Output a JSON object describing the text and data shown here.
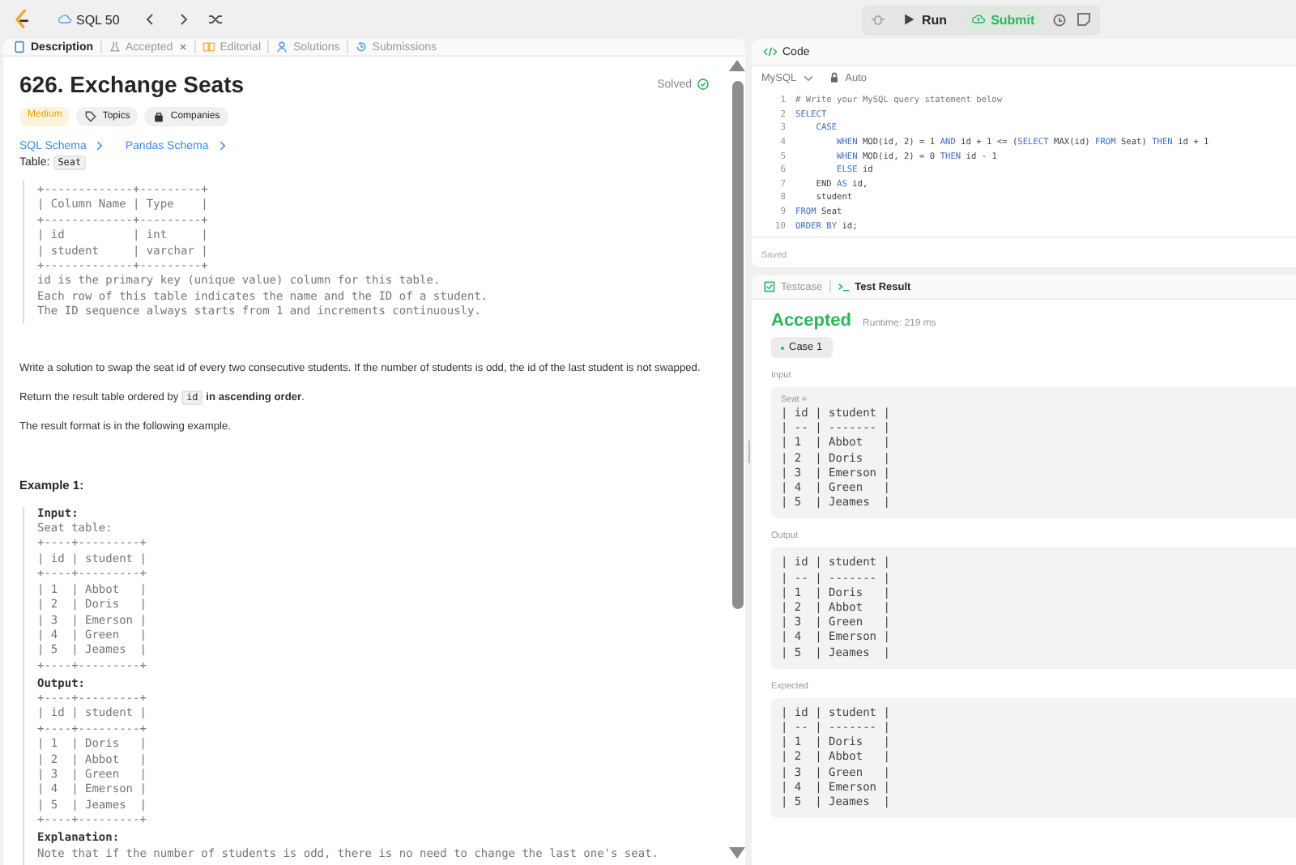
{
  "top_bar": {
    "problem_list": "SQL 50",
    "run": "Run",
    "submit": "Submit"
  },
  "description_tabs": [
    {
      "label": "Description",
      "selected": true,
      "closable": false
    },
    {
      "label": "Accepted",
      "selected": false,
      "closable": true
    },
    {
      "label": "Editorial",
      "selected": false,
      "closable": false
    },
    {
      "label": "Solutions",
      "selected": false,
      "closable": false
    },
    {
      "label": "Submissions",
      "selected": false,
      "closable": false
    }
  ],
  "problem": {
    "title": "626. Exchange Seats",
    "status": "Solved",
    "difficulty": "Medium",
    "tags": [
      "Topics",
      "Companies"
    ],
    "schema_links": [
      "SQL Schema",
      "Pandas Schema"
    ],
    "table_label": "Table:",
    "table_name": "Seat",
    "schema_block": "+-------------+---------+\n| Column Name | Type    |\n+-------------+---------+\n| id          | int     |\n| student     | varchar |\n+-------------+---------+\nid is the primary key (unique value) column for this table.\nEach row of this table indicates the name and the ID of a student.\nThe ID sequence always starts from 1 and increments continuously.",
    "paragraphs": [
      [
        {
          "kind": "plain",
          "text": "Write a solution to swap the seat id of every two consecutive students. If the number of students is odd, the id of the last student is not swapped."
        }
      ],
      [
        {
          "kind": "plain",
          "text": "Return the result table ordered by "
        },
        {
          "kind": "code",
          "text": "id"
        },
        {
          "kind": "bold",
          "text": " in ascending order"
        },
        {
          "kind": "plain",
          "text": "."
        }
      ],
      [
        {
          "kind": "plain",
          "text": "The result format is in the following example."
        }
      ]
    ],
    "example": {
      "title": "Example 1:",
      "sections": [
        {
          "label": "Input:",
          "text": "Seat table:\n+----+---------+\n| id | student |\n+----+---------+\n| 1  | Abbot   |\n| 2  | Doris   |\n| 3  | Emerson |\n| 4  | Green   |\n| 5  | Jeames  |\n+----+---------+"
        },
        {
          "label": "Output:",
          "text": "+----+---------+\n| id | student |\n+----+---------+\n| 1  | Doris   |\n| 2  | Abbot   |\n| 3  | Green   |\n| 4  | Emerson |\n| 5  | Jeames  |\n+----+---------+"
        },
        {
          "label": "Explanation:",
          "text": "Note that if the number of students is odd, there is no need to change the last one's seat."
        }
      ]
    }
  },
  "code_panel": {
    "title": "Code",
    "language": "MySQL",
    "mode": "Auto",
    "status": "Saved",
    "lines": [
      {
        "number": "1",
        "tokens": [
          {
            "kind": "comment",
            "text": "# Write your MySQL query statement below"
          }
        ]
      },
      {
        "number": "2",
        "tokens": [
          {
            "kind": "keyword",
            "text": "SELECT"
          }
        ]
      },
      {
        "number": "3",
        "tokens": [
          {
            "kind": "keyword",
            "text": "    CASE"
          }
        ]
      },
      {
        "number": "4",
        "tokens": [
          {
            "kind": "keyword",
            "text": "        WHEN"
          },
          {
            "kind": "plain",
            "text": " MOD(id, 2) = 1 "
          },
          {
            "kind": "keyword",
            "text": "AND"
          },
          {
            "kind": "plain",
            "text": " id + 1 <= ("
          },
          {
            "kind": "keyword",
            "text": "SELECT"
          },
          {
            "kind": "plain",
            "text": " MAX(id) "
          },
          {
            "kind": "keyword",
            "text": "FROM"
          },
          {
            "kind": "plain",
            "text": " Seat) "
          },
          {
            "kind": "keyword",
            "text": "THEN"
          },
          {
            "kind": "plain",
            "text": " id + 1"
          }
        ]
      },
      {
        "number": "5",
        "tokens": [
          {
            "kind": "keyword",
            "text": "        WHEN"
          },
          {
            "kind": "plain",
            "text": " MOD(id, 2) = 0 "
          },
          {
            "kind": "keyword",
            "text": "THEN"
          },
          {
            "kind": "plain",
            "text": " id - 1"
          }
        ]
      },
      {
        "number": "6",
        "tokens": [
          {
            "kind": "keyword",
            "text": "        ELSE"
          },
          {
            "kind": "plain",
            "text": " id"
          }
        ]
      },
      {
        "number": "7",
        "tokens": [
          {
            "kind": "plain",
            "text": "    END "
          },
          {
            "kind": "keyword",
            "text": "AS"
          },
          {
            "kind": "plain",
            "text": " id,"
          }
        ]
      },
      {
        "number": "8",
        "tokens": [
          {
            "kind": "plain",
            "text": "    student"
          }
        ]
      },
      {
        "number": "9",
        "tokens": [
          {
            "kind": "keyword",
            "text": "FROM"
          },
          {
            "kind": "plain",
            "text": " Seat"
          }
        ]
      },
      {
        "number": "10",
        "tokens": [
          {
            "kind": "keyword",
            "text": "ORDER BY"
          },
          {
            "kind": "plain",
            "text": " id;"
          }
        ]
      }
    ]
  },
  "result_panel": {
    "tabs": [
      {
        "label": "Testcase",
        "selected": false
      },
      {
        "label": "Test Result",
        "selected": true
      }
    ],
    "verdict": "Accepted",
    "runtime": "Runtime: 219 ms",
    "cases": [
      {
        "label": "Case 1",
        "selected": true
      }
    ],
    "sections": [
      {
        "label": "Input",
        "caption": "Seat =",
        "text": "| id | student |\n| -- | ------- |\n| 1  | Abbot   |\n| 2  | Doris   |\n| 3  | Emerson |\n| 4  | Green   |\n| 5  | Jeames  |"
      },
      {
        "label": "Output",
        "text": "| id | student |\n| -- | ------- |\n| 1  | Doris   |\n| 2  | Abbot   |\n| 3  | Green   |\n| 4  | Emerson |\n| 5  | Jeames  |"
      },
      {
        "label": "Expected",
        "text": "| id | student |\n| -- | ------- |\n| 1  | Doris   |\n| 2  | Abbot   |\n| 3  | Green   |\n| 4  | Emerson |\n| 5  | Jeames  |"
      }
    ]
  }
}
